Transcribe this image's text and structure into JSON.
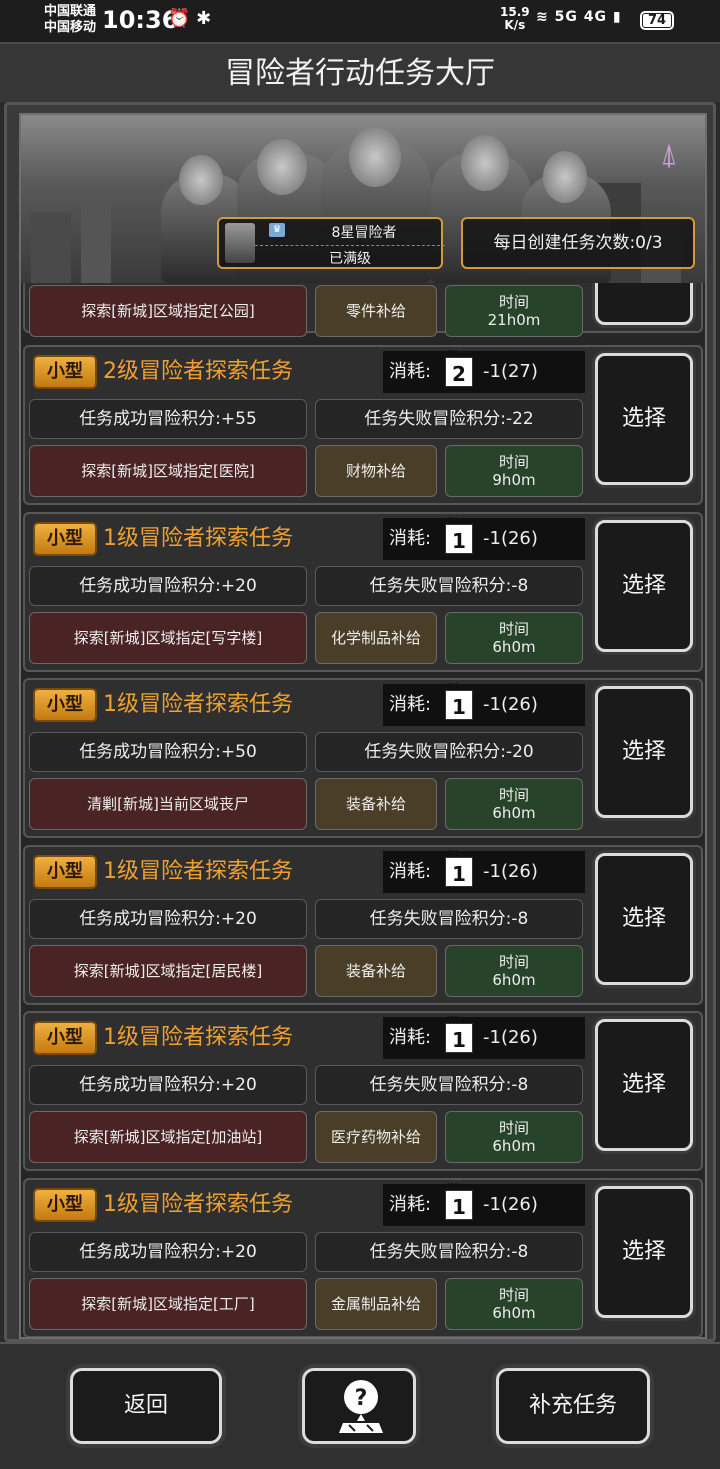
{
  "status_bar": {
    "carrier1": "中国联通",
    "carrier2": "中国移动",
    "time": "10:36",
    "net_speed_value": "15.9",
    "net_speed_unit": "K/s",
    "signal_text": "5G 4G",
    "battery": "74"
  },
  "title": "冒险者行动任务大厅",
  "banner": {
    "rank": "8星冒险者",
    "rank_status": "已满级",
    "daily_create": "每日创建任务次数:0/3"
  },
  "partial_card": {
    "area": "探索[新城]区域指定[公园]",
    "supply": "零件补给",
    "time_label": "时间",
    "time_value": "21h0m"
  },
  "cost_label": "消耗:",
  "select_label": "选择",
  "time_label": "时间",
  "tasks": [
    {
      "size": "小型",
      "title": "2级冒险者探索任务",
      "level": "2",
      "cost": "-1(27)",
      "success": "任务成功冒险积分:+55",
      "fail": "任务失败冒险积分:-22",
      "area": "探索[新城]区域指定[医院]",
      "supply": "财物补给",
      "time": "9h0m"
    },
    {
      "size": "小型",
      "title": "1级冒险者探索任务",
      "level": "1",
      "cost": "-1(26)",
      "success": "任务成功冒险积分:+20",
      "fail": "任务失败冒险积分:-8",
      "area": "探索[新城]区域指定[写字楼]",
      "supply": "化学制品补给",
      "time": "6h0m"
    },
    {
      "size": "小型",
      "title": "1级冒险者探索任务",
      "level": "1",
      "cost": "-1(26)",
      "success": "任务成功冒险积分:+50",
      "fail": "任务失败冒险积分:-20",
      "area": "清剿[新城]当前区域丧尸",
      "supply": "装备补给",
      "time": "6h0m"
    },
    {
      "size": "小型",
      "title": "1级冒险者探索任务",
      "level": "1",
      "cost": "-1(26)",
      "success": "任务成功冒险积分:+20",
      "fail": "任务失败冒险积分:-8",
      "area": "探索[新城]区域指定[居民楼]",
      "supply": "装备补给",
      "time": "6h0m"
    },
    {
      "size": "小型",
      "title": "1级冒险者探索任务",
      "level": "1",
      "cost": "-1(26)",
      "success": "任务成功冒险积分:+20",
      "fail": "任务失败冒险积分:-8",
      "area": "探索[新城]区域指定[加油站]",
      "supply": "医疗药物补给",
      "time": "6h0m"
    },
    {
      "size": "小型",
      "title": "1级冒险者探索任务",
      "level": "1",
      "cost": "-1(26)",
      "success": "任务成功冒险积分:+20",
      "fail": "任务失败冒险积分:-8",
      "area": "探索[新城]区域指定[工厂]",
      "supply": "金属制品补给",
      "time": "6h0m"
    }
  ],
  "bottom": {
    "back": "返回",
    "help_icon": "help-map-icon",
    "refill": "补充任务"
  }
}
